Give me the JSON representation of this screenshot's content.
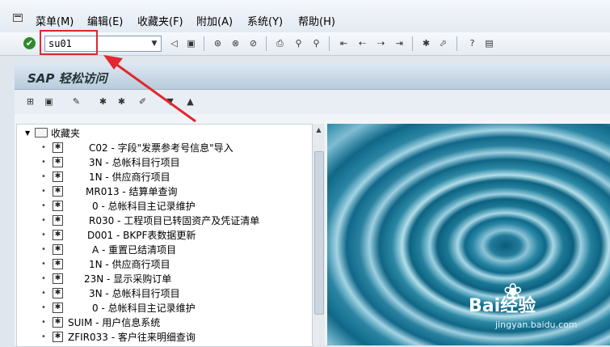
{
  "menu": {
    "items": [
      "菜单(M)",
      "编辑(E)",
      "收藏夹(F)",
      "附加(A)",
      "系统(Y)",
      "帮助(H)"
    ]
  },
  "toolbar": {
    "command_value": "su01"
  },
  "title": "SAP 轻松访问",
  "tree": {
    "root": "收藏夹",
    "items": [
      "C02 - 字段\"发票参考号信息\"导入",
      "3N - 总帐科目行项目",
      "1N - 供应商行项目",
      "MR013 - 结算单查询",
      "0 - 总帐科目主记录维护",
      "R030 - 工程项目已转固资产及凭证清单",
      "D001 - BKPF表数据更新",
      "A - 重置已结清项目",
      "1N - 供应商行项目",
      "23N - 显示采购订单",
      "3N - 总帐科目行项目",
      "0 - 总帐科目主记录维护",
      "SUIM - 用户信息系统",
      "ZFIR033 - 客户往来明细查询"
    ]
  },
  "watermark": {
    "logo": "Bai经验",
    "url": "jingyan.baidu.com"
  },
  "colors": {
    "highlight": "#e0282e",
    "arrow": "#e0282e"
  }
}
